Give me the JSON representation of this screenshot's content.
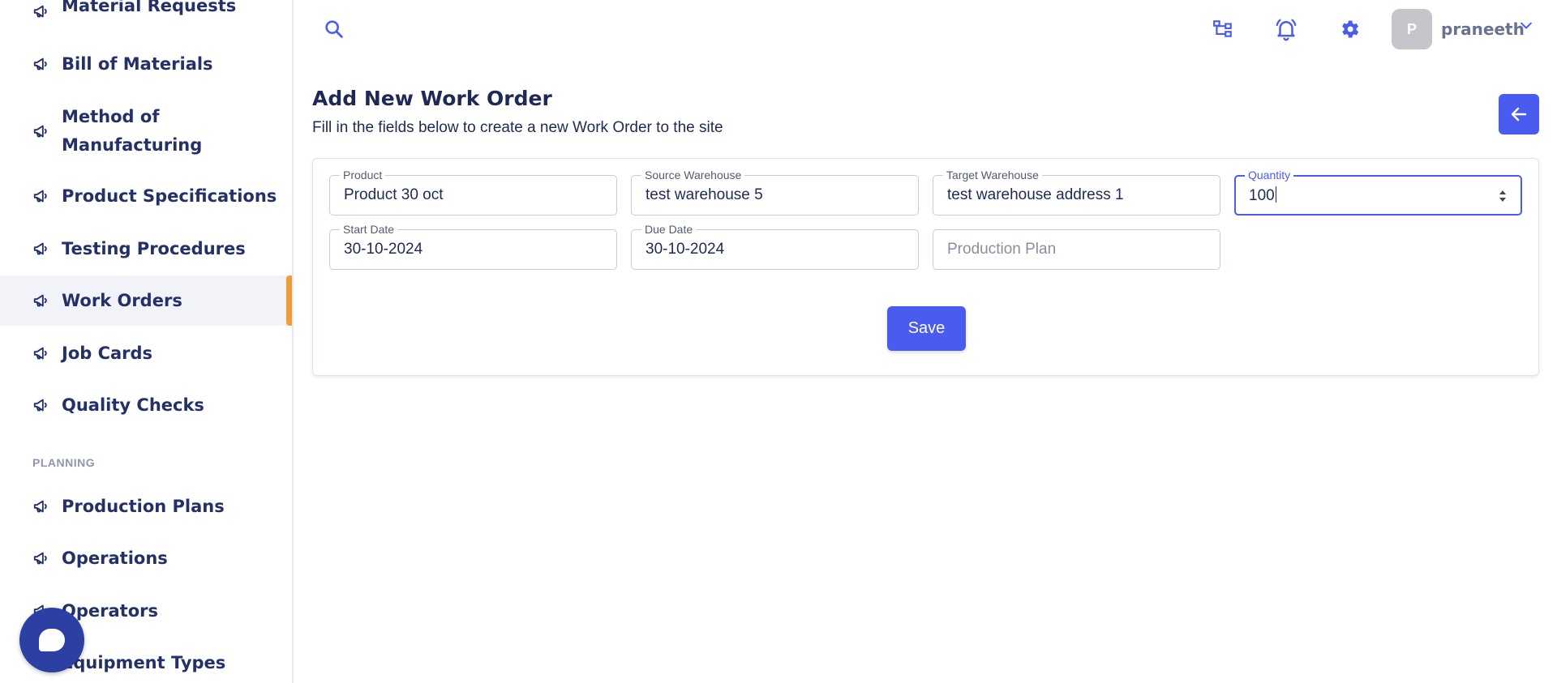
{
  "sidebar": {
    "items": [
      {
        "label": "Material Requests"
      },
      {
        "label": "Bill of Materials"
      },
      {
        "label_line1": "Method of",
        "label_line2": "Manufacturing"
      },
      {
        "label": "Product Specifications"
      },
      {
        "label": "Testing Procedures"
      },
      {
        "label": "Work Orders",
        "active": true
      },
      {
        "label": "Job Cards"
      },
      {
        "label": "Quality Checks"
      },
      {
        "label": "Production Plans"
      },
      {
        "label": "Operations"
      },
      {
        "label": "Operators"
      },
      {
        "label": "Equipment Types"
      }
    ],
    "section_planning": "PLANNING"
  },
  "header": {
    "avatar_initial": "P",
    "username": "praneeth"
  },
  "page": {
    "title": "Add New Work Order",
    "subtitle": "Fill in the fields below to create a new Work Order to the site"
  },
  "form": {
    "product": {
      "label": "Product",
      "value": "Product 30 oct"
    },
    "source_warehouse": {
      "label": "Source Warehouse",
      "value": "test warehouse 5"
    },
    "target_warehouse": {
      "label": "Target Warehouse",
      "value": "test warehouse address 1"
    },
    "quantity": {
      "label": "Quantity",
      "value": "100"
    },
    "start_date": {
      "label": "Start Date",
      "value": "30-10-2024"
    },
    "due_date": {
      "label": "Due Date",
      "value": "30-10-2024"
    },
    "production_plan": {
      "placeholder": "Production Plan"
    },
    "save_label": "Save"
  },
  "colors": {
    "accent": "#4a5cf0",
    "active_indicator": "#f29b38",
    "nav_text": "#243168",
    "chat_fab": "#2c3fa3"
  },
  "icons": {
    "nav": "megaphone-icon",
    "search": "search-icon",
    "hierarchy": "hierarchy-icon",
    "notifications": "bell-icon",
    "settings": "gear-icon",
    "user_menu": "chevron-down-icon",
    "back": "arrow-left-icon",
    "chat": "chat-icon"
  }
}
